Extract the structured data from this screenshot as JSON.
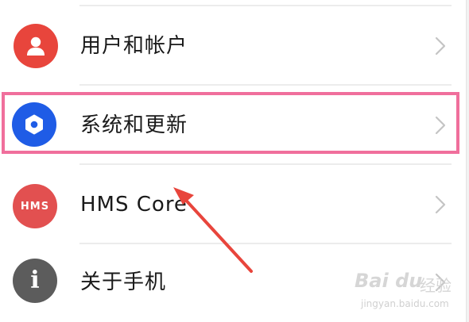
{
  "settings_list": {
    "items": [
      {
        "label": "用户和帐户",
        "icon": "person-icon",
        "icon_color": "#e8453c"
      },
      {
        "label": "系统和更新",
        "icon": "gear-icon",
        "icon_color": "#1f5ce6"
      },
      {
        "label": "HMS Core",
        "icon_text": "HMS",
        "icon": "hms-logo-icon",
        "icon_color": "#e25050"
      },
      {
        "label": "关于手机",
        "icon_text": "i",
        "icon": "info-icon",
        "icon_color": "#5c5c5c"
      }
    ],
    "highlight_color": "#f06f9c",
    "arrow_color": "#e8453c"
  },
  "watermark": {
    "logo": "Bai du",
    "suffix": "经验",
    "url": "jingyan.baidu.com"
  }
}
